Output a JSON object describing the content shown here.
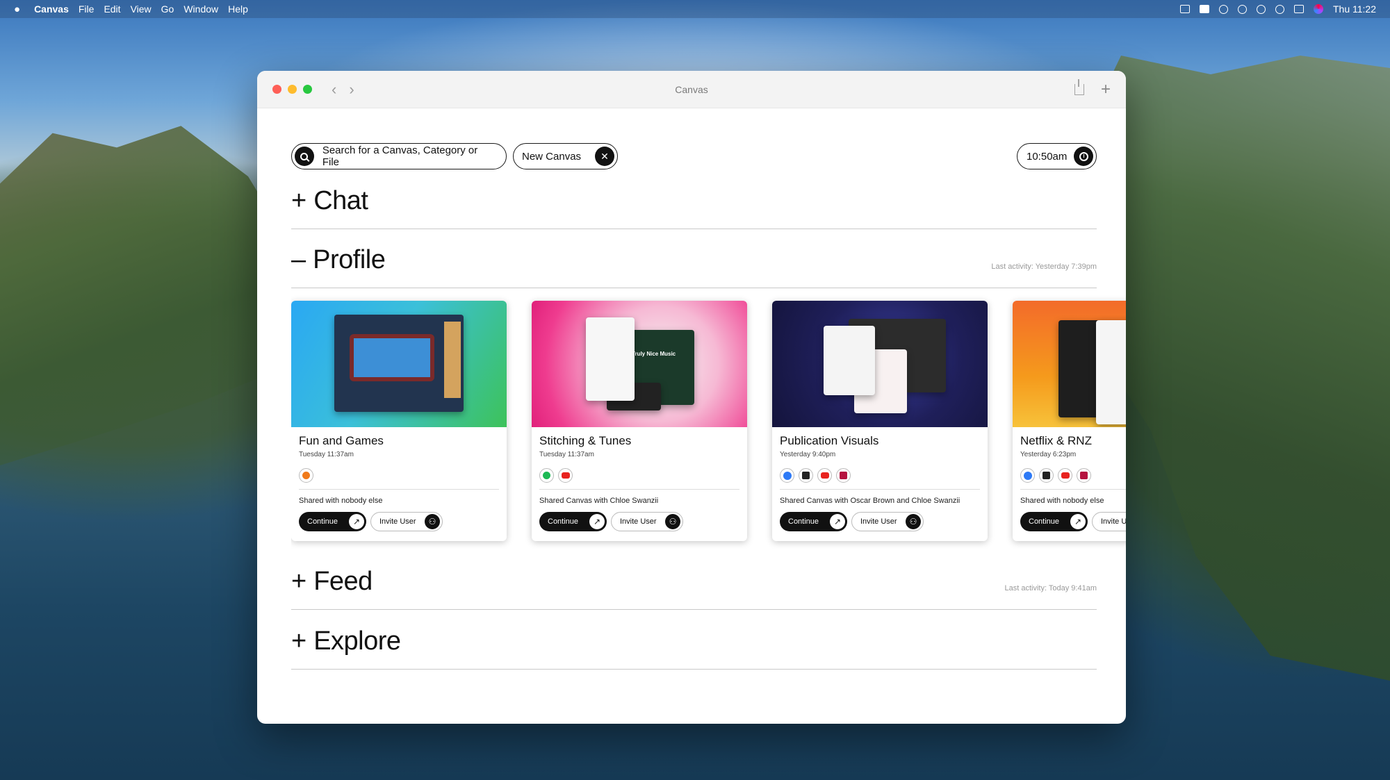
{
  "menubar": {
    "apple": "",
    "app_name": "Canvas",
    "items": [
      "File",
      "Edit",
      "View",
      "Go",
      "Window",
      "Help"
    ],
    "clock": "Thu 11:22"
  },
  "window": {
    "title": "Canvas",
    "back": "‹",
    "forward": "›",
    "add": "+"
  },
  "controls": {
    "search_label": "Search for a Canvas, Category or File",
    "new_canvas_label": "New Canvas",
    "time_label": "10:50am"
  },
  "sections": {
    "chat": {
      "toggle": "+",
      "title": "Chat"
    },
    "profile": {
      "toggle": "–",
      "title": "Profile",
      "last_activity": "Last activity: Yesterday 7:39pm"
    },
    "feed": {
      "toggle": "+",
      "title": "Feed",
      "last_activity": "Last activity: Today 9:41am"
    },
    "explore": {
      "toggle": "+",
      "title": "Explore"
    }
  },
  "cards": [
    {
      "title": "Fun and Games",
      "date": "Tuesday 11:37am",
      "apps": [
        "m-icon"
      ],
      "shared": "Shared with nobody else",
      "continue": "Continue",
      "invite": "Invite User"
    },
    {
      "title": "Stitching & Tunes",
      "date": "Tuesday 11:37am",
      "apps": [
        "spotify-icon",
        "youtube-icon"
      ],
      "shared": "Shared Canvas with Chloe Swanzii",
      "continue": "Continue",
      "invite": "Invite User",
      "thumb_text": "Truly Nice Music"
    },
    {
      "title": "Publication Visuals",
      "date": "Yesterday 9:40pm",
      "apps": [
        "messenger-icon",
        "acrobat-icon",
        "youtube-icon",
        "indesign-icon"
      ],
      "shared": "Shared Canvas with Oscar Brown and Chloe Swanzii",
      "continue": "Continue",
      "invite": "Invite User"
    },
    {
      "title": "Netflix & RNZ",
      "date": "Yesterday 6:23pm",
      "apps": [
        "messenger-icon",
        "acrobat-icon",
        "youtube-icon",
        "indesign-icon"
      ],
      "shared": "Shared with nobody else",
      "continue": "Continue",
      "invite": "Invite User"
    }
  ]
}
